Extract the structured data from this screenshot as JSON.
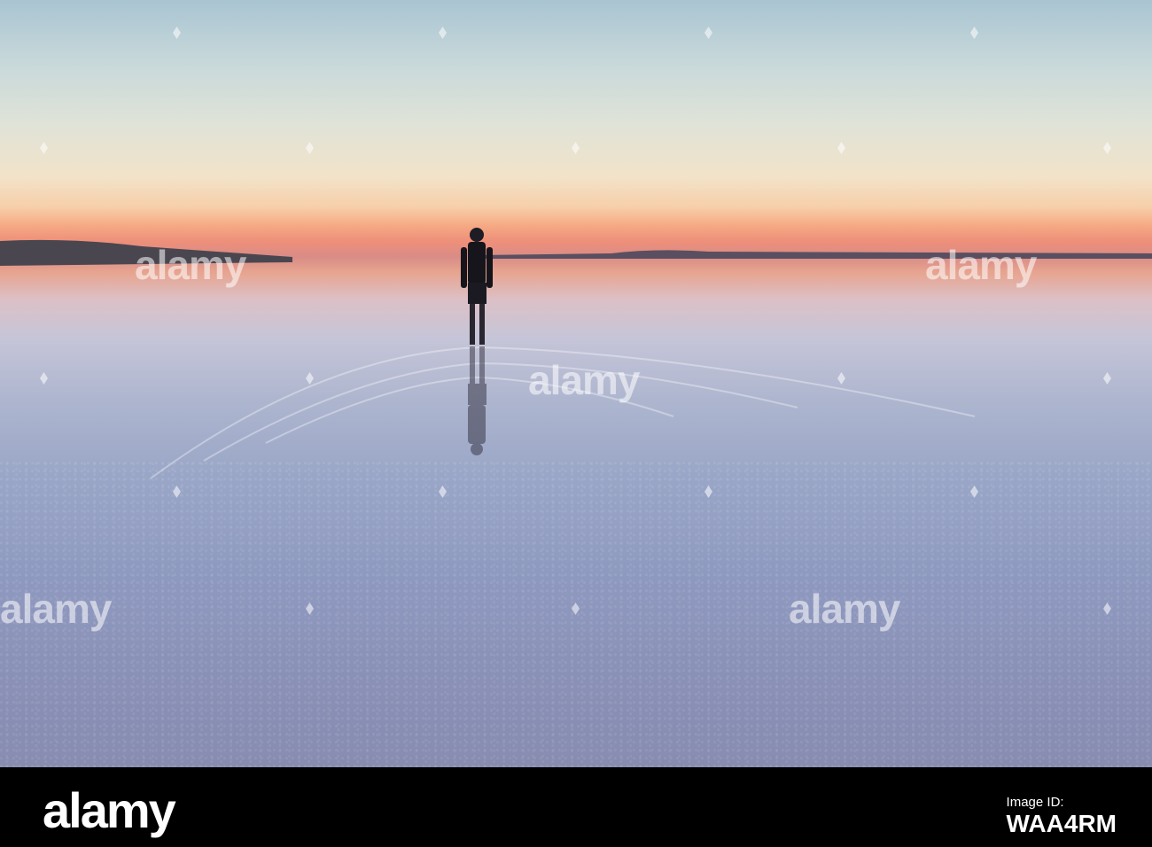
{
  "watermark": {
    "text": "alamy"
  },
  "footer": {
    "logo_text": "alamy",
    "image_id_label": "Image ID:",
    "image_id": "WAA4RM"
  },
  "colors": {
    "sky_top": "#a9c4d2",
    "sunset_band": "#ee8f7a",
    "salt_flat": "#8b92b8",
    "footer_bg": "#000000"
  }
}
